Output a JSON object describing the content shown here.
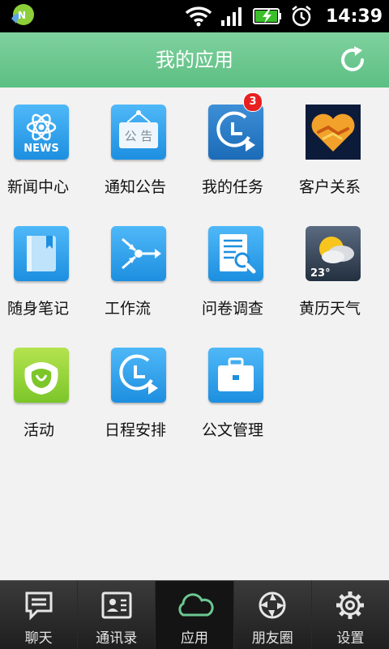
{
  "status_bar": {
    "time": "14:39"
  },
  "header": {
    "title": "我的应用"
  },
  "apps": [
    {
      "label": "新闻中心",
      "icon": "news-icon",
      "icon_text": "NEWS"
    },
    {
      "label": "通知公告",
      "icon": "notice-board-icon",
      "icon_text": "公 告"
    },
    {
      "label": "我的任务",
      "icon": "task-clock-icon",
      "badge": "3"
    },
    {
      "label": "客户关系",
      "icon": "handshake-heart-icon"
    },
    {
      "label": "随身笔记",
      "icon": "notebook-icon"
    },
    {
      "label": "工作流",
      "icon": "workflow-icon"
    },
    {
      "label": "问卷调查",
      "icon": "survey-icon"
    },
    {
      "label": "黄历天气",
      "icon": "weather-icon",
      "icon_text": "23°"
    },
    {
      "label": "活动",
      "icon": "activity-icon"
    },
    {
      "label": "日程安排",
      "icon": "schedule-icon"
    },
    {
      "label": "公文管理",
      "icon": "briefcase-icon"
    }
  ],
  "tabs": [
    {
      "label": "聊天",
      "icon": "chat-icon"
    },
    {
      "label": "通讯录",
      "icon": "contacts-icon"
    },
    {
      "label": "应用",
      "icon": "cloud-icon",
      "active": true
    },
    {
      "label": "朋友圈",
      "icon": "aperture-icon"
    },
    {
      "label": "设置",
      "icon": "gear-icon"
    }
  ],
  "colors": {
    "header_green": "#6cc792",
    "icon_blue": "#2a9be8",
    "badge_red": "#e82020",
    "tabbar_dark": "#2b2b2b"
  }
}
